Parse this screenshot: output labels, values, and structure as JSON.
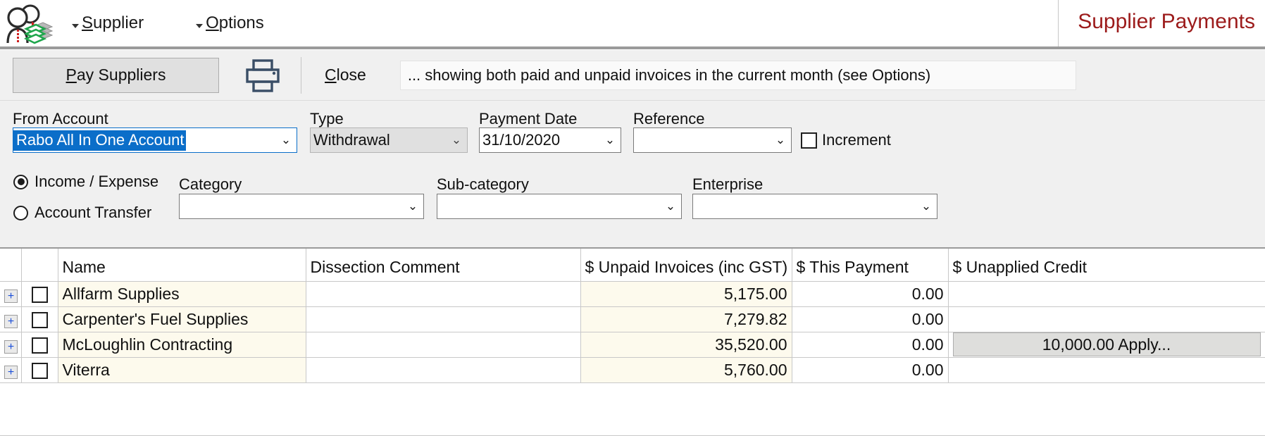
{
  "header": {
    "app_icon": "supplier-payments-icon",
    "menus": [
      {
        "label_pre": "",
        "accel": "S",
        "label_post": "upplier",
        "name": "supplier"
      },
      {
        "label_pre": "",
        "accel": "O",
        "label_post": "ptions",
        "name": "options"
      }
    ],
    "menu_supplier_accel": "S",
    "menu_supplier_rest": "upplier",
    "menu_options_accel": "O",
    "menu_options_rest": "ptions",
    "title": "Supplier Payments",
    "title_color": "#9c1b1b"
  },
  "toolbar": {
    "pay_suppliers_accel": "P",
    "pay_suppliers_rest": "ay Suppliers",
    "print_icon": "printer-icon",
    "close_accel": "C",
    "close_rest": "lose",
    "info_text": "... showing both paid and unpaid invoices in the current month (see Options)"
  },
  "form": {
    "from_account": {
      "label": "From Account",
      "value": "Rabo All In One Account",
      "chevron": "⌄"
    },
    "type": {
      "label": "Type",
      "value": "Withdrawal",
      "chevron": "⌄",
      "disabled": true
    },
    "payment_date": {
      "label": "Payment Date",
      "value": "31/10/2020",
      "chevron": "⌄"
    },
    "reference": {
      "label": "Reference",
      "value": "",
      "chevron": "⌄"
    },
    "increment": {
      "label": "Increment",
      "checked": false
    },
    "mode": {
      "income_expense_label": "Income / Expense",
      "account_transfer_label": "Account Transfer",
      "selected": "Income / Expense"
    },
    "category": {
      "label": "Category",
      "value": "",
      "chevron": "⌄"
    },
    "subcategory": {
      "label": "Sub-category",
      "value": "",
      "chevron": "⌄"
    },
    "enterprise": {
      "label": "Enterprise",
      "value": "",
      "chevron": "⌄"
    }
  },
  "grid": {
    "columns": [
      {
        "key": "expand",
        "label": ""
      },
      {
        "key": "check",
        "label": ""
      },
      {
        "key": "name",
        "label": "Name",
        "sorted": "asc"
      },
      {
        "key": "dissection",
        "label": "Dissection Comment"
      },
      {
        "key": "unpaid",
        "label": "$ Unpaid Invoices (inc GST)"
      },
      {
        "key": "this_payment",
        "label": "$ This Payment"
      },
      {
        "key": "credit",
        "label": "$ Unapplied Credit"
      }
    ],
    "expand_glyph": "+",
    "rows": [
      {
        "name": "Allfarm Supplies",
        "dissection": "",
        "unpaid": "5,175.00",
        "this_payment": "0.00",
        "credit": "",
        "checked": false
      },
      {
        "name": "Carpenter's Fuel Supplies",
        "dissection": "",
        "unpaid": "7,279.82",
        "this_payment": "0.00",
        "credit": "",
        "checked": false
      },
      {
        "name": "McLoughlin Contracting",
        "dissection": "",
        "unpaid": "35,520.00",
        "this_payment": "0.00",
        "credit": "10,000.00 Apply...",
        "checked": false
      },
      {
        "name": "Viterra",
        "dissection": "",
        "unpaid": "5,760.00",
        "this_payment": "0.00",
        "credit": "",
        "checked": false
      }
    ]
  },
  "colors": {
    "title_red": "#9c1b1b",
    "selection_blue": "#0b6ec9",
    "row_cream": "#fdfaed",
    "panel_gray": "#f0f0f0",
    "printer_navy": "#3a4e66",
    "money_green": "#21a14a"
  }
}
